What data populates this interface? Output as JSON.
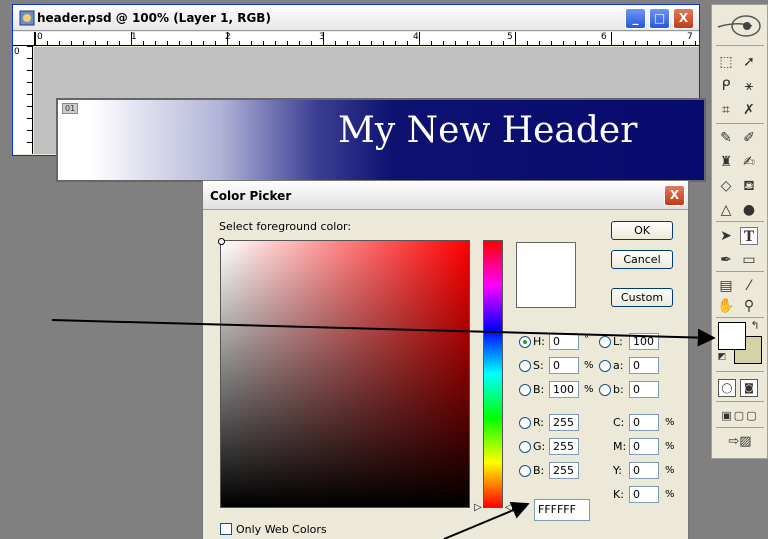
{
  "document": {
    "title": "header.psd @ 100% (Layer 1, RGB)",
    "ruler_numbers": [
      "0",
      "1",
      "2",
      "3",
      "4",
      "5",
      "6",
      "7"
    ],
    "zoom_badge": "01",
    "header_text": "My New Header"
  },
  "window_controls": {
    "minimize": "_",
    "maximize": "□",
    "close": "X"
  },
  "color_picker": {
    "title": "Color Picker",
    "prompt": "Select foreground color:",
    "buttons": {
      "ok": "OK",
      "cancel": "Cancel",
      "custom": "Custom"
    },
    "hsb": [
      {
        "label": "H:",
        "value": "0",
        "unit": "°",
        "selected": true
      },
      {
        "label": "S:",
        "value": "0",
        "unit": "%",
        "selected": false
      },
      {
        "label": "B:",
        "value": "100",
        "unit": "%",
        "selected": false
      }
    ],
    "rgb": [
      {
        "label": "R:",
        "value": "255"
      },
      {
        "label": "G:",
        "value": "255"
      },
      {
        "label": "B:",
        "value": "255"
      }
    ],
    "lab": [
      {
        "label": "L:",
        "value": "100"
      },
      {
        "label": "a:",
        "value": "0"
      },
      {
        "label": "b:",
        "value": "0"
      }
    ],
    "cmyk": [
      {
        "label": "C:",
        "value": "0",
        "unit": "%"
      },
      {
        "label": "M:",
        "value": "0",
        "unit": "%"
      },
      {
        "label": "Y:",
        "value": "0",
        "unit": "%"
      },
      {
        "label": "K:",
        "value": "0",
        "unit": "%"
      }
    ],
    "hex": "FFFFFF",
    "web_only_label": "Only Web Colors",
    "web_only_checked": false,
    "current_color": "#ffffff"
  },
  "toolbox": {
    "foreground_color": "#ffffff",
    "background_color": "#d5d2a5",
    "tools": [
      "marquee-icon",
      "move-icon",
      "lasso-icon",
      "magic-wand-icon",
      "crop-icon",
      "slice-icon",
      "healing-brush-icon",
      "brush-icon",
      "stamp-icon",
      "history-brush-icon",
      "eraser-icon",
      "paint-bucket-icon",
      "blur-icon",
      "dodge-icon",
      "path-select-icon",
      "type-icon",
      "pen-icon",
      "shape-icon",
      "notes-icon",
      "eyedropper-icon",
      "hand-icon",
      "zoom-icon"
    ]
  },
  "colors": {
    "header_dark": "#080b6e",
    "title_blue": "#0831d9"
  }
}
